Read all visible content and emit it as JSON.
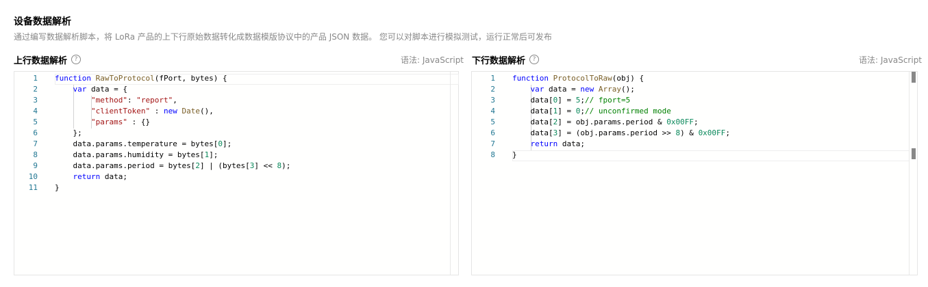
{
  "header": {
    "title": "设备数据解析",
    "description": "通过编写数据解析脚本，将 LoRa 产品的上下行原始数据转化成数据模版协议中的产品 JSON 数据。 您可以对脚本进行模拟测试，运行正常后可发布"
  },
  "uplink": {
    "title": "上行数据解析",
    "help": "?",
    "lang_label": "语法: JavaScript",
    "line_numbers": [
      "1",
      "2",
      "3",
      "4",
      "5",
      "6",
      "7",
      "8",
      "9",
      "10",
      "11"
    ]
  },
  "downlink": {
    "title": "下行数据解析",
    "help": "?",
    "lang_label": "语法: JavaScript",
    "line_numbers": [
      "1",
      "2",
      "3",
      "4",
      "5",
      "6",
      "7",
      "8"
    ]
  },
  "code": {
    "up": {
      "l1_kw": "function",
      "l1_fn": "RawToProtocol",
      "l1_rest": "(fPort, bytes) {",
      "l2_kw": "var",
      "l2_rest": " data = {",
      "l3_str1": "\"method\"",
      "l3_rest": ": ",
      "l3_str2": "\"report\"",
      "l3_end": ",",
      "l4_str": "\"clientToken\"",
      "l4_rest": " : ",
      "l4_kw": "new",
      "l4_fn": " Date",
      "l4_end": "(),",
      "l5_str": "\"params\"",
      "l5_rest": " : {}",
      "l6": "};",
      "l7_a": "data.params.temperature = bytes[",
      "l7_n": "0",
      "l7_b": "];",
      "l8_a": "data.params.humidity = bytes[",
      "l8_n": "1",
      "l8_b": "];",
      "l9_a": "data.params.period = bytes[",
      "l9_n1": "2",
      "l9_b": "] | (bytes[",
      "l9_n2": "3",
      "l9_c": "] << ",
      "l9_n3": "8",
      "l9_d": ");",
      "l10_kw": "return",
      "l10_rest": " data;",
      "l11": "}"
    },
    "down": {
      "l1_kw": "function",
      "l1_fn": "ProtocolToRaw",
      "l1_rest": "(obj) {",
      "l2_kw": "var",
      "l2_rest": " data = ",
      "l2_kw2": "new",
      "l2_fn": " Array",
      "l2_end": "();",
      "l3_a": "data[",
      "l3_n": "0",
      "l3_b": "] = ",
      "l3_n2": "5",
      "l3_c": ";",
      "l3_com": "// fport=5",
      "l4_a": "data[",
      "l4_n": "1",
      "l4_b": "] = ",
      "l4_n2": "0",
      "l4_c": ";",
      "l4_com": "// unconfirmed mode",
      "l5_a": "data[",
      "l5_n": "2",
      "l5_b": "] = obj.params.period & ",
      "l5_n2": "0x00FF",
      "l5_c": ";",
      "l6_a": "data[",
      "l6_n": "3",
      "l6_b": "] = (obj.params.period >> ",
      "l6_n2": "8",
      "l6_c": ") & ",
      "l6_n3": "0x00FF",
      "l6_d": ";",
      "l7_kw": "return",
      "l7_rest": " data;",
      "l8": "}"
    }
  },
  "colors": {
    "keyword": "#0000ff",
    "function": "#795e26",
    "string": "#a31515",
    "number": "#09885a",
    "comment": "#008000",
    "line_number": "#237893"
  }
}
